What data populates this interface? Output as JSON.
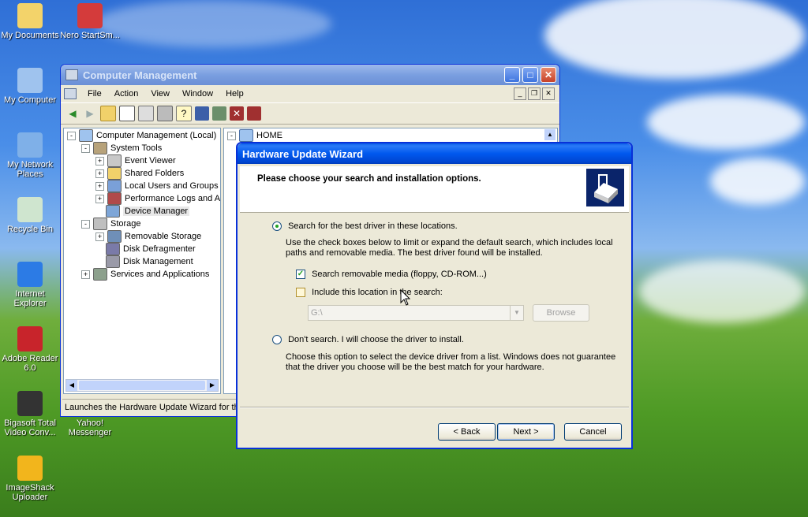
{
  "desktop": {
    "icons": [
      {
        "label": "My Documents",
        "icon": "folder-icon",
        "color": "#f3d36a"
      },
      {
        "label": "Nero StartSm...",
        "icon": "nero-icon",
        "color": "#d43b3b"
      },
      {
        "label": "My Computer",
        "icon": "computer-icon",
        "color": "#9fc3ee"
      },
      {
        "label": "My Network Places",
        "icon": "network-icon",
        "color": "#7fb0e8"
      },
      {
        "label": "Recycle Bin",
        "icon": "recycle-bin-icon",
        "color": "#cfe5cf"
      },
      {
        "label": "Internet Explorer",
        "icon": "internet-explorer-icon",
        "color": "#2c7be5"
      },
      {
        "label": "Adobe Reader 6.0",
        "icon": "adobe-reader-icon",
        "color": "#c8242b"
      },
      {
        "label": "Bigasoft Total Video Conv...",
        "icon": "bigasoft-icon",
        "color": "#333333"
      },
      {
        "label": "Yahoo! Messenger",
        "icon": "yahoo-icon",
        "color": "#7b0099"
      },
      {
        "label": "ImageShack Uploader",
        "icon": "imageshack-icon",
        "color": "#f2b51c"
      }
    ]
  },
  "computer_management": {
    "title": "Computer Management",
    "menu": [
      "File",
      "Action",
      "View",
      "Window",
      "Help"
    ],
    "tree": [
      {
        "label": "Computer Management (Local)",
        "level": 0,
        "expander": "-",
        "icon": "computer-management-icon"
      },
      {
        "label": "System Tools",
        "level": 1,
        "expander": "-",
        "icon": "system-tools-icon"
      },
      {
        "label": "Event Viewer",
        "level": 2,
        "expander": "+",
        "icon": "event-viewer-icon"
      },
      {
        "label": "Shared Folders",
        "level": 2,
        "expander": "+",
        "icon": "shared-folders-icon"
      },
      {
        "label": "Local Users and Groups",
        "level": 2,
        "expander": "+",
        "icon": "users-icon"
      },
      {
        "label": "Performance Logs and Alerts",
        "level": 2,
        "expander": "+",
        "icon": "performance-icon"
      },
      {
        "label": "Device Manager",
        "level": 2,
        "expander": "",
        "icon": "device-manager-icon",
        "selected": true
      },
      {
        "label": "Storage",
        "level": 1,
        "expander": "-",
        "icon": "storage-icon"
      },
      {
        "label": "Removable Storage",
        "level": 2,
        "expander": "+",
        "icon": "removable-storage-icon"
      },
      {
        "label": "Disk Defragmenter",
        "level": 2,
        "expander": "",
        "icon": "defrag-icon"
      },
      {
        "label": "Disk Management",
        "level": 2,
        "expander": "",
        "icon": "disk-management-icon"
      },
      {
        "label": "Services and Applications",
        "level": 1,
        "expander": "+",
        "icon": "services-icon"
      }
    ],
    "right_pane_root": "HOME",
    "status": "Launches the Hardware Update Wizard for the"
  },
  "wizard": {
    "title": "Hardware Update Wizard",
    "header": "Please choose your search and installation options.",
    "option_search": {
      "label": "Search for the best driver in these locations.",
      "description": "Use the check boxes below to limit or expand the default search, which includes local paths and removable media. The best driver found will be installed.",
      "selected": true
    },
    "check_removable": {
      "label": "Search removable media (floppy, CD-ROM...)",
      "checked": true
    },
    "check_location": {
      "label": "Include this location in the search:",
      "checked": false
    },
    "location_value": "G:\\",
    "browse_label": "Browse",
    "option_manual": {
      "label": "Don't search. I will choose the driver to install.",
      "description": "Choose this option to select the device driver from a list.  Windows does not guarantee that the driver you choose will be the best match for your hardware.",
      "selected": false
    },
    "buttons": {
      "back": "< Back",
      "next": "Next >",
      "cancel": "Cancel"
    }
  }
}
